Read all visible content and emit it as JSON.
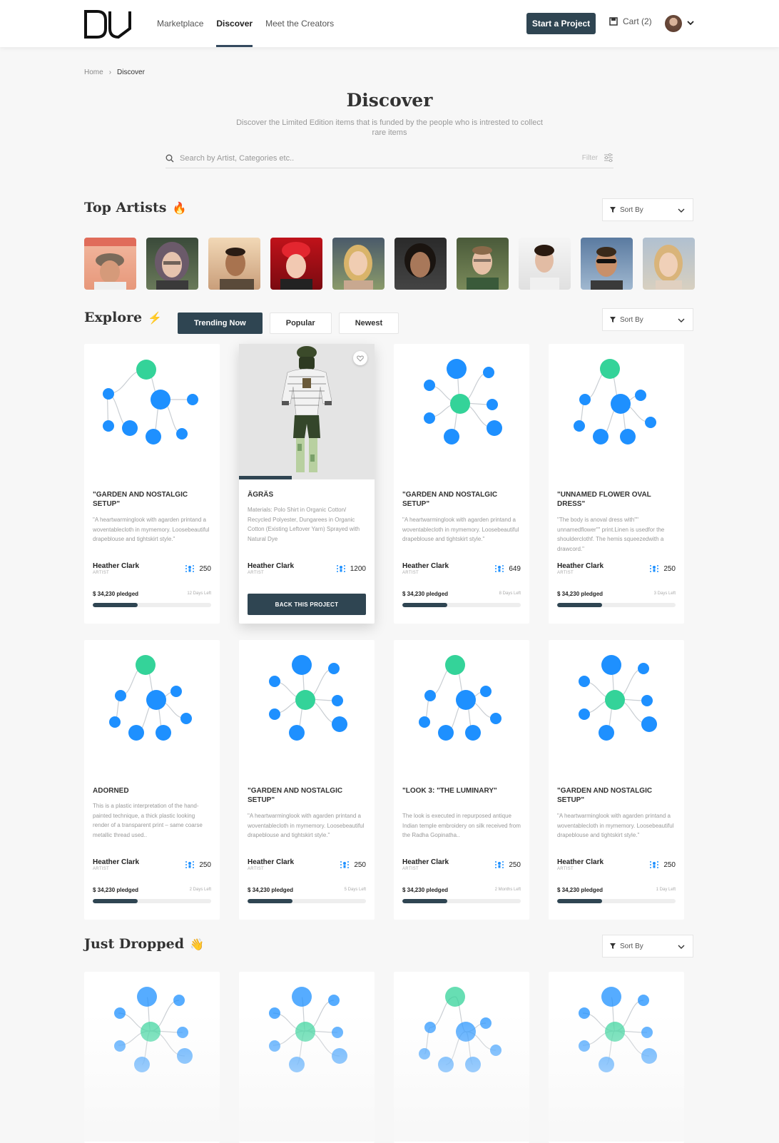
{
  "header": {
    "logo_text": "DV",
    "nav": [
      {
        "label": "Marketplace",
        "active": false
      },
      {
        "label": "Discover",
        "active": true
      },
      {
        "label": "Meet the Creators",
        "active": false
      }
    ],
    "start_button": "Start a Project",
    "cart_label": "Cart (2)"
  },
  "breadcrumb": {
    "home": "Home",
    "current": "Discover"
  },
  "page": {
    "title": "Discover",
    "subtitle": "Discover the Limited Edition items that is funded by the people who is intrested to collect rare items"
  },
  "search": {
    "placeholder": "Search by Artist, Categories etc..",
    "filter_label": "Filter"
  },
  "sort_label": "Sort By",
  "top_artists": {
    "title": "Top Artists",
    "emoji": "🔥"
  },
  "explore": {
    "title": "Explore",
    "emoji": "⚡",
    "tabs": [
      {
        "label": "Trending Now",
        "active": true
      },
      {
        "label": "Popular",
        "active": false
      },
      {
        "label": "Newest",
        "active": false
      }
    ]
  },
  "just_dropped": {
    "title": "Just Dropped",
    "emoji": "👋"
  },
  "artist_role": "ARTIST",
  "back_button": "BACK THIS PROJECT",
  "cards": [
    {
      "name": "\"GARDEN AND NOSTALGIC SETUP\"",
      "desc": "\"A heartwarminglook with agarden printand a woventablecloth in mymemory. Loosebeautiful drapeblouse and tightskirt style.\"",
      "creator": "Heather Clark",
      "count": "250",
      "pledged": "$ 34,230 pledged",
      "time_left": "12 Days Left",
      "progress": 0.38
    },
    {
      "name": "ÄGRÄS",
      "desc": "Materials: Polo Shirt in Organic Cotton/ Recycled Polyester, Dungarees in Organic Cotton (Existing Leftover Yarn) Sprayed with Natural Dye",
      "creator": "Heather Clark",
      "count": "1200",
      "featured": true
    },
    {
      "name": "\"GARDEN AND NOSTALGIC SETUP\"",
      "desc": "\"A heartwarminglook with agarden printand a woventablecloth in mymemory. Loosebeautiful drapeblouse and tightskirt style.\"",
      "creator": "Heather Clark",
      "count": "649",
      "pledged": "$ 34,230 pledged",
      "time_left": "8 Days Left",
      "progress": 0.38
    },
    {
      "name": "\"UNNAMED FLOWER OVAL DRESS\"",
      "desc": "\"The body is anoval dress with\"\" unnamedflower\"\" print.Linen is usedfor the shoulderclothf. The hemis squeezedwith a drawcord.\"",
      "creator": "Heather Clark",
      "count": "250",
      "pledged": "$ 34,230 pledged",
      "time_left": "3 Days Left",
      "progress": 0.38
    },
    {
      "name": "ADORNED",
      "desc": "This is a plastic interpretation of the hand-painted technique, a thick plastic looking render of a transparent print – same coarse metallic thread used..",
      "creator": "Heather Clark",
      "count": "250",
      "pledged": "$ 34,230 pledged",
      "time_left": "2 Days Left",
      "progress": 0.38
    },
    {
      "name": "\"GARDEN AND NOSTALGIC SETUP\"",
      "desc": "\"A heartwarminglook with agarden printand a woventablecloth in mymemory. Loosebeautiful drapeblouse and tightskirt style.\"",
      "creator": "Heather Clark",
      "count": "250",
      "pledged": "$ 34,230 pledged",
      "time_left": "5 Days Left",
      "progress": 0.38
    },
    {
      "name": "\"LOOK 3: \"THE LUMINARY\"",
      "desc": "The look is executed in repurposed antique Indian temple embroidery on silk received from the Radha Gopinatha..",
      "creator": "Heather Clark",
      "count": "250",
      "pledged": "$ 34,230 pledged",
      "time_left": "2 Months Left",
      "progress": 0.38
    },
    {
      "name": "\"GARDEN AND NOSTALGIC SETUP\"",
      "desc": "\"A heartwarminglook with agarden printand a woventablecloth in mymemory. Loosebeautiful drapeblouse and tightskirt style.\"",
      "creator": "Heather Clark",
      "count": "250",
      "pledged": "$ 34,230 pledged",
      "time_left": "1 Day Left",
      "progress": 0.38
    }
  ],
  "colors": {
    "accent": "#2f4552",
    "node_blue": "#1e90ff",
    "node_green": "#34d399"
  }
}
